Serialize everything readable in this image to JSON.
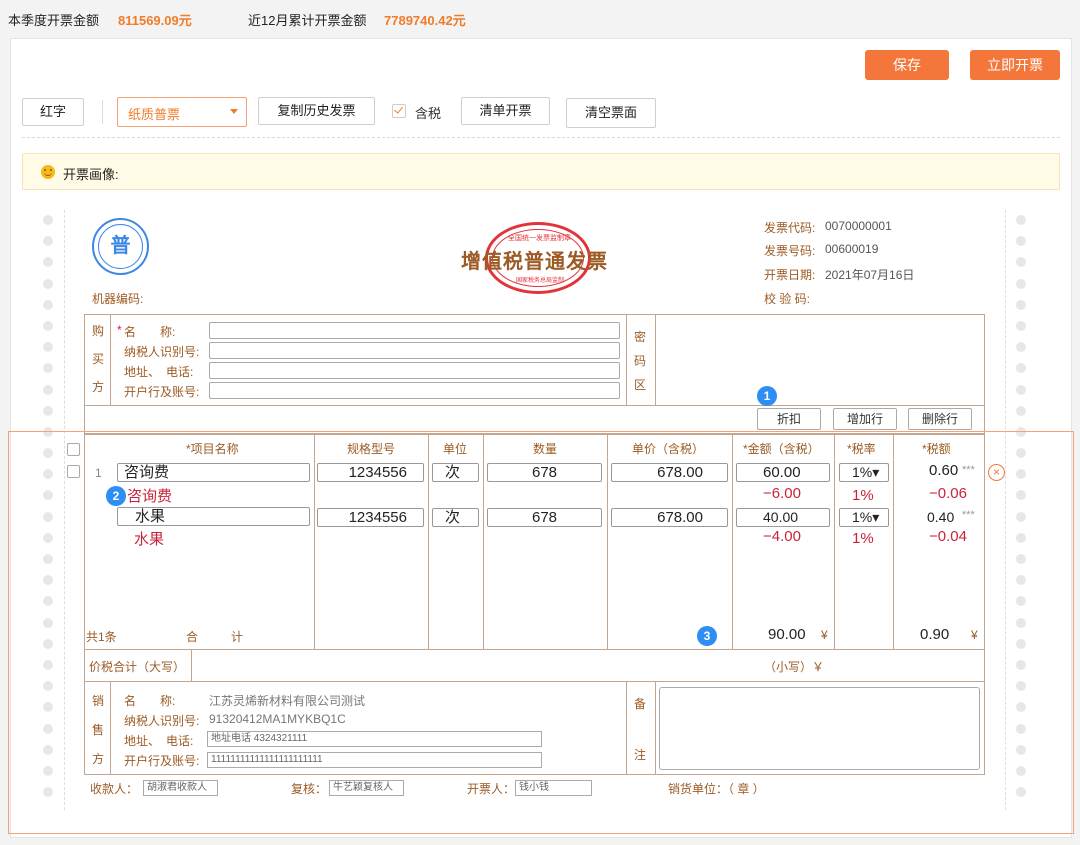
{
  "stats": {
    "quarter_label": "本季度开票金额",
    "quarter_value": "811569.09元",
    "year_label": "近12月累计开票金额",
    "year_value": "7789740.42元"
  },
  "actions": {
    "save": "保存",
    "issue_now": "立即开票"
  },
  "toolbar": {
    "red_label": "红字",
    "invoice_type": "纸质普票",
    "copy_history": "复制历史发票",
    "tax_inclusive": "含税",
    "tax_inclusive_checked": true,
    "list_invoice": "清单开票",
    "clear_invoice": "清空票面"
  },
  "notice": {
    "text": "开票画像:"
  },
  "invoice": {
    "stamp_char": "普",
    "title": "增值税普通发票",
    "seal_top": "全国统一发票监制章",
    "seal_bottom": "国家税务总局监制",
    "machine_code_label": "机器编码:",
    "code_label": "发票代码:",
    "code_value": "0070000001",
    "number_label": "发票号码:",
    "number_value": "00600019",
    "date_label": "开票日期:",
    "date_value": "2021年07月16日",
    "check_label": "校 验 码:",
    "buyer": {
      "side": [
        "购",
        "买",
        "方"
      ],
      "name_label": "名　　称:",
      "taxid_label": "纳税人识别号:",
      "addr_label": "地址、　电话:",
      "bank_label": "开户行及账号:"
    },
    "cipher_side": [
      "密",
      "码",
      "区"
    ],
    "row_actions": {
      "discount": "折扣",
      "add_row": "增加行",
      "delete_row": "删除行"
    },
    "headers": {
      "item": "*项目名称",
      "spec": "规格型号",
      "unit": "单位",
      "qty": "数量",
      "price": "单价（含税）",
      "amount": "*金额（含税）",
      "rate": "*税率",
      "tax": "*税额"
    },
    "rows": [
      {
        "index": "1",
        "item": "咨询费",
        "spec": "1234556",
        "unit": "次",
        "qty": "678",
        "price": "678.00",
        "amount": "60.00",
        "rate": "1%▾",
        "tax": "0.60",
        "tax_mask": "***",
        "discount_item": "咨询费",
        "discount_amount": "−6.00",
        "discount_rate": "1%",
        "discount_tax": "−0.06"
      },
      {
        "index": "",
        "item": "水果",
        "spec": "1234556",
        "unit": "次",
        "qty": "678",
        "price": "678.00",
        "amount": "40.00",
        "rate": "1%▾",
        "tax": "0.40",
        "tax_mask": "***",
        "discount_item": "水果",
        "discount_amount": "−4.00",
        "discount_rate": "1%",
        "discount_tax": "−0.04"
      }
    ],
    "badges": [
      "1",
      "2",
      "3"
    ],
    "total_count": "共1条",
    "total_label_1": "合",
    "total_label_2": "计",
    "total_amount": "90.00",
    "total_tax": "0.90",
    "currency": "¥",
    "sum_upper_label": "价税合计（大写）",
    "sum_lower_label": "（小写）￥",
    "seller": {
      "side": [
        "销",
        "售",
        "方"
      ],
      "name_label": "名　　称:",
      "name_value": "江苏灵烯新材料有限公司测试",
      "taxid_label": "纳税人识别号:",
      "taxid_value": "91320412MA1MYKBQ1C",
      "addr_label": "地址、　电话:",
      "addr_value": "地址电话 4324321111",
      "bank_label": "开户行及账号:",
      "bank_value": "11111111111111111111111"
    },
    "remark_side": [
      "备",
      "注"
    ],
    "payee_label": "收款人：",
    "payee_value": "胡淑君收款人",
    "reviewer_label": "复核：",
    "reviewer_value": "牛艺颖复核人",
    "drawer_label": "开票人：",
    "drawer_value": "钱小钱",
    "seller_unit_label": "销货单位：（ 章 ）"
  }
}
